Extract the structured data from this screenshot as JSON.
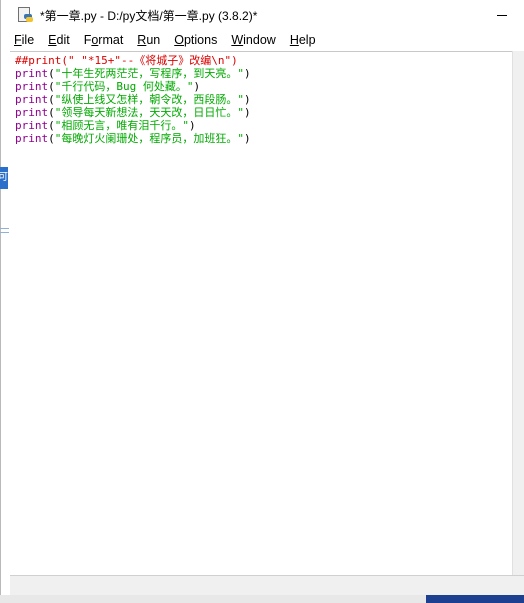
{
  "window": {
    "title": "*第一章.py - D:/py文档/第一章.py (3.8.2)*"
  },
  "menu": [
    {
      "pre": "",
      "key": "F",
      "post": "ile"
    },
    {
      "pre": "",
      "key": "E",
      "post": "dit"
    },
    {
      "pre": "F",
      "key": "o",
      "post": "rmat"
    },
    {
      "pre": "",
      "key": "R",
      "post": "un"
    },
    {
      "pre": "",
      "key": "O",
      "post": "ptions"
    },
    {
      "pre": "",
      "key": "W",
      "post": "indow"
    },
    {
      "pre": "",
      "key": "H",
      "post": "elp"
    }
  ],
  "code": [
    [
      {
        "cls": "comment",
        "text": "##print(\" \"*15+\"--《将城子》改编\\n\")"
      }
    ],
    [
      {
        "cls": "builtin",
        "text": "print"
      },
      {
        "cls": "plain",
        "text": "("
      },
      {
        "cls": "str",
        "text": "\"十年生死两茫茫，写程序，到天亮。\""
      },
      {
        "cls": "plain",
        "text": ")"
      }
    ],
    [
      {
        "cls": "builtin",
        "text": "print"
      },
      {
        "cls": "plain",
        "text": "("
      },
      {
        "cls": "str",
        "text": "\"千行代码，Bug 何处藏。\""
      },
      {
        "cls": "plain",
        "text": ")"
      }
    ],
    [
      {
        "cls": "builtin",
        "text": "print"
      },
      {
        "cls": "plain",
        "text": "("
      },
      {
        "cls": "str",
        "text": "\"纵使上线又怎样，朝令改，西段肠。\""
      },
      {
        "cls": "plain",
        "text": ")"
      }
    ],
    [
      {
        "cls": "builtin",
        "text": "print"
      },
      {
        "cls": "plain",
        "text": "("
      },
      {
        "cls": "str",
        "text": "\"领导每天新想法，天天改，日日忙。\""
      },
      {
        "cls": "plain",
        "text": ")"
      }
    ],
    [
      {
        "cls": "builtin",
        "text": "print"
      },
      {
        "cls": "plain",
        "text": "("
      },
      {
        "cls": "str",
        "text": "\"相顾无言，唯有泪千行。\""
      },
      {
        "cls": "plain",
        "text": ")"
      }
    ],
    [
      {
        "cls": "builtin",
        "text": "print"
      },
      {
        "cls": "plain",
        "text": "("
      },
      {
        "cls": "str",
        "text": "\"每晚灯火阑珊处，程序员，加班狂。\""
      },
      {
        "cls": "plain",
        "text": ")"
      }
    ]
  ],
  "behind_window": {
    "tab_text": "可"
  }
}
